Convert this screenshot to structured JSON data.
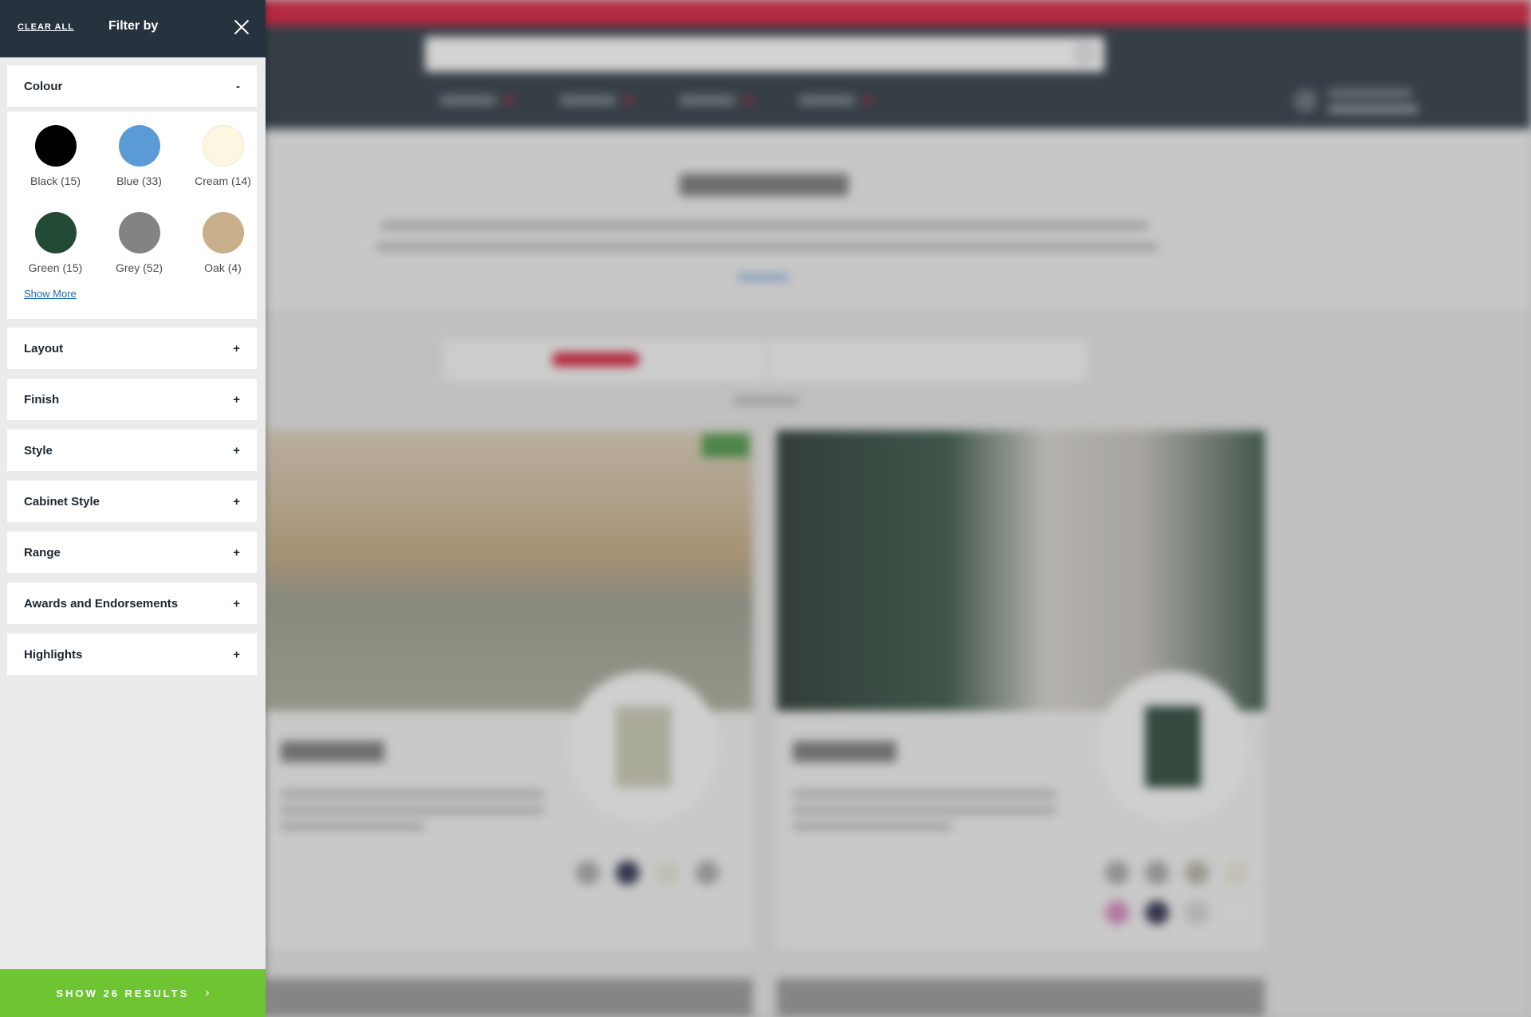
{
  "filter_panel": {
    "clear_all_label": "CLEAR ALL",
    "title": "Filter by",
    "close_icon": "close-icon",
    "colour": {
      "label": "Colour",
      "toggle": "-",
      "swatches": [
        {
          "name": "Black (15)",
          "color": "#000000"
        },
        {
          "name": "Blue (33)",
          "color": "#5b9bd5"
        },
        {
          "name": "Cream (14)",
          "color": "#fdf7e1"
        },
        {
          "name": "Green (15)",
          "color": "#234a35"
        },
        {
          "name": "Grey (52)",
          "color": "#838383"
        },
        {
          "name": "Oak (4)",
          "color": "#c8ae8a"
        }
      ],
      "show_more": "Show More"
    },
    "sections": [
      {
        "label": "Layout",
        "toggle": "+"
      },
      {
        "label": "Finish",
        "toggle": "+"
      },
      {
        "label": "Style",
        "toggle": "+"
      },
      {
        "label": "Cabinet Style",
        "toggle": "+"
      },
      {
        "label": "Range",
        "toggle": "+"
      },
      {
        "label": "Awards and Endorsements",
        "toggle": "+"
      },
      {
        "label": "Highlights",
        "toggle": "+"
      }
    ],
    "footer_button": "SHOW 26 RESULTS",
    "footer_chevron": "›"
  },
  "colors": {
    "header_bg": "#26333f",
    "panel_bg": "#ebebeb",
    "footer_green": "#6ec531",
    "brand_red": "#c8102e",
    "link_blue": "#1f67b8"
  }
}
